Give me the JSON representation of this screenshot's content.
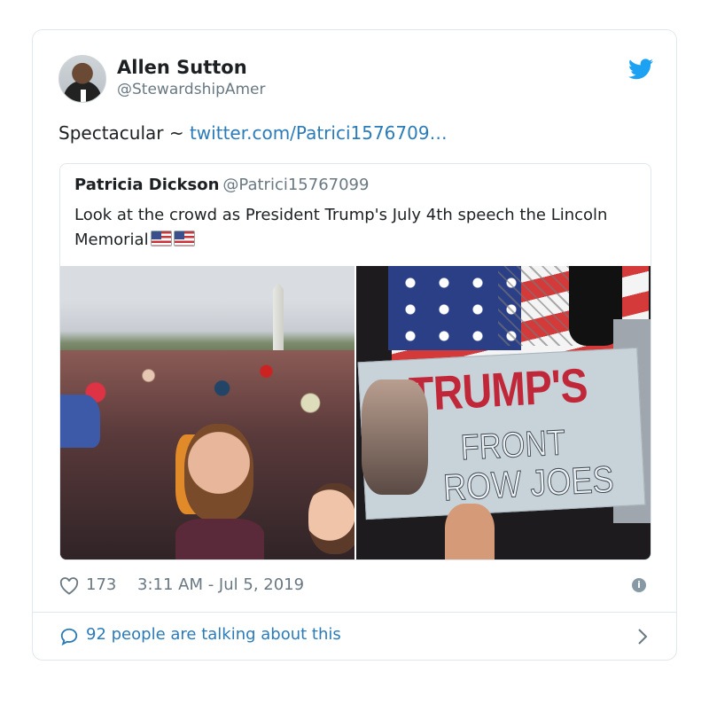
{
  "author": {
    "name": "Allen Sutton",
    "handle": "@StewardshipAmer"
  },
  "tweet": {
    "text": "Spectacular ~ ",
    "link": "twitter.com/Patrici1576709…"
  },
  "quoted": {
    "name": "Patricia Dickson",
    "handle": "@Patrici15767099",
    "text": "Look at the crowd as President Trump's July 4th speech  the Lincoln Memorial",
    "sign_line1": "TRUMP'S",
    "sign_line2": "FRONT",
    "sign_line3": "ROW JOES"
  },
  "footer": {
    "likes": "173",
    "timestamp": "3:11 AM - Jul 5, 2019",
    "talking": "92 people are talking about this"
  },
  "colors": {
    "link": "#2b7bb9",
    "muted": "#697882",
    "border": "#e1e8ed"
  },
  "icons": {
    "brand": "twitter-bird-icon",
    "like": "heart-icon",
    "info": "info-icon",
    "reply": "chat-bubble-icon",
    "more": "chevron-right-icon",
    "emoji": "us-flag-icon"
  }
}
